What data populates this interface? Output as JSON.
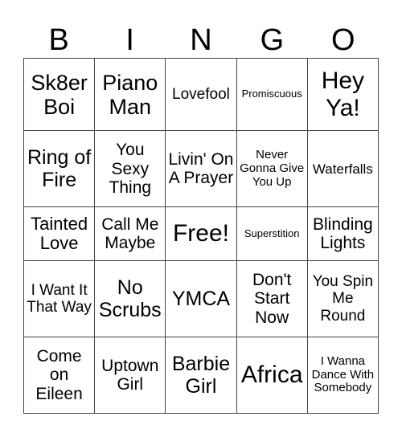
{
  "header": {
    "letters": [
      "B",
      "I",
      "N",
      "G",
      "O"
    ]
  },
  "grid": {
    "rows": [
      [
        "Sk8er Boi",
        "Piano Man",
        "Lovefool",
        "Promiscuous",
        "Hey Ya!"
      ],
      [
        "Ring of Fire",
        "You Sexy Thing",
        "Livin' On A Prayer",
        "Never Gonna Give You Up",
        "Waterfalls"
      ],
      [
        "Tainted Love",
        "Call Me Maybe",
        "Free!",
        "Superstition",
        "Blinding Lights"
      ],
      [
        "I Want It That Way",
        "No Scrubs",
        "YMCA",
        "Don't Start Now",
        "You Spin Me Round"
      ],
      [
        "Come on Eileen",
        "Uptown Girl",
        "Barbie Girl",
        "Africa",
        "I Wanna Dance With Somebody"
      ]
    ]
  }
}
